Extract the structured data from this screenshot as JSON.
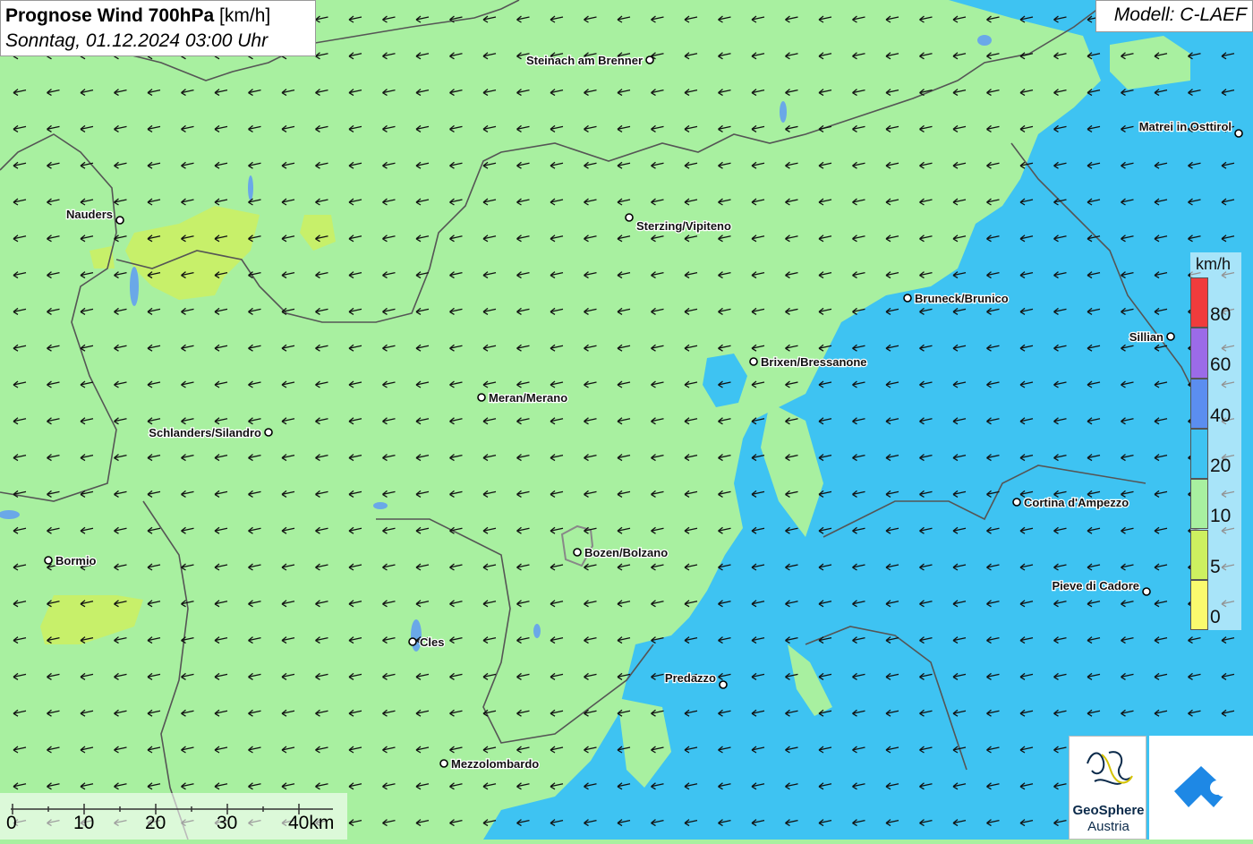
{
  "title": {
    "main": "Prognose Wind 700hPa",
    "unit": "[km/h]",
    "datetime": "Sonntag, 01.12.2024 03:00 Uhr"
  },
  "model": "Modell: C-LAEF",
  "legend": {
    "unit": "km/h",
    "items": [
      {
        "label": "80",
        "color": "#f03c3c"
      },
      {
        "label": "60",
        "color": "#9b6be8"
      },
      {
        "label": "40",
        "color": "#5b8ef0"
      },
      {
        "label": "20",
        "color": "#3ec3f2"
      },
      {
        "label": "10",
        "color": "#a8f0a0"
      },
      {
        "label": "5",
        "color": "#cdf060"
      },
      {
        "label": "0",
        "color": "#fafa6e"
      }
    ]
  },
  "scale": {
    "ticks": [
      "0",
      "10",
      "20",
      "30",
      "40km"
    ]
  },
  "cities": [
    {
      "name": "Steinach am Brenner"
    },
    {
      "name": "Matrei in Osttirol"
    },
    {
      "name": "Nauders"
    },
    {
      "name": "Sterzing/Vipiteno"
    },
    {
      "name": "Bruneck/Brunico"
    },
    {
      "name": "Sillian"
    },
    {
      "name": "Brixen/Bressanone"
    },
    {
      "name": "Meran/Merano"
    },
    {
      "name": "Schlanders/Silandro"
    },
    {
      "name": "Cortina d'Ampezzo"
    },
    {
      "name": "Bormio"
    },
    {
      "name": "Bozen/Bolzano"
    },
    {
      "name": "Pieve di Cadore"
    },
    {
      "name": "Cles"
    },
    {
      "name": "Predazzo"
    },
    {
      "name": "Mezzolombardo"
    }
  ],
  "logos": {
    "geosphere_line1": "GeoSphere",
    "geosphere_line2": "Austria"
  },
  "colors": {
    "wind_10_20": "#a8f0a0",
    "wind_20_40": "#3ec3f2",
    "wind_5_10": "#cdf060",
    "border": "#555555",
    "water": "#6aa8e8"
  },
  "wind_direction": "from east-northeast (arrows pointing west)"
}
